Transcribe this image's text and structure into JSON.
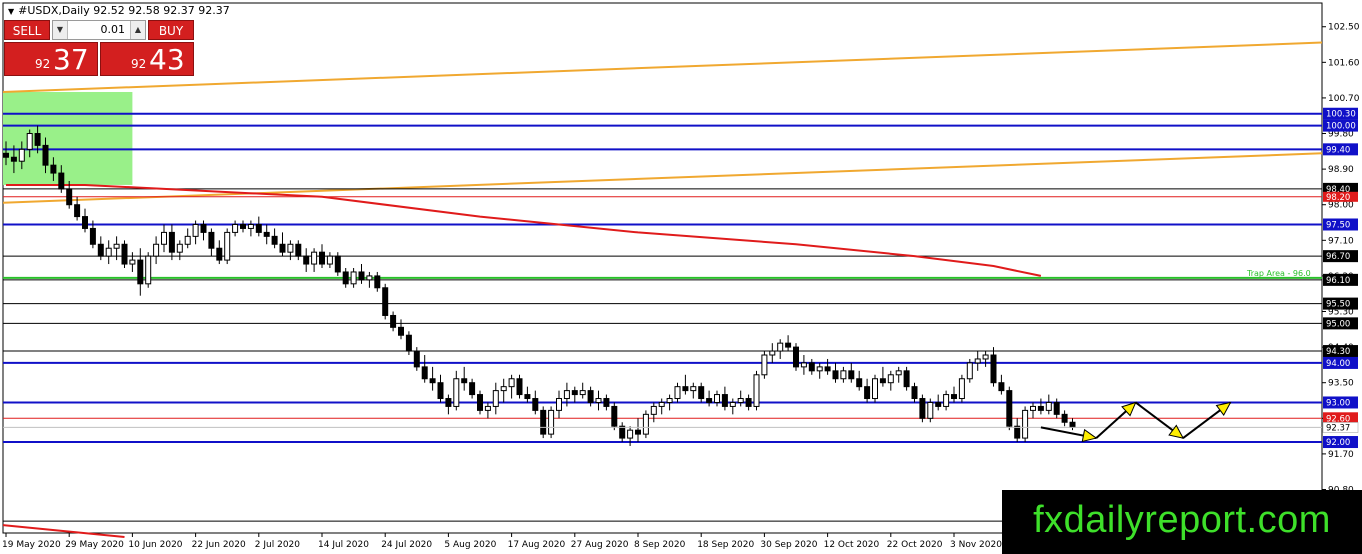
{
  "header": {
    "title_text": "#USDX,Daily  92.52 92.58 92.37 92.37"
  },
  "trade_panel": {
    "sell_label": "SELL",
    "buy_label": "BUY",
    "lot_value": "0.01",
    "sell_price_small": "92",
    "sell_price_big": "37",
    "buy_price_small": "92",
    "buy_price_big": "43"
  },
  "watermark": "fxdailyreport.com",
  "colors": {
    "bull_candle": "#ffffff",
    "bear_candle": "#000000",
    "sma": "#e01b1b",
    "channel": "#f0a830",
    "level_blue": "#1010c8",
    "level_black": "#000000",
    "level_green": "#29c02a",
    "supply_zone": "#99f089",
    "forecast_arrow": "#ffee00"
  },
  "chart_data": {
    "type": "candlestick",
    "symbol": "#USDX",
    "timeframe": "Daily",
    "ylim": [
      89.7,
      103.1
    ],
    "y_ticks": [
      "102.50",
      "101.60",
      "100.70",
      "99.80",
      "98.90",
      "98.00",
      "97.10",
      "96.20",
      "95.30",
      "94.40",
      "93.50",
      "92.60",
      "91.70",
      "90.80"
    ],
    "y_tick_values": [
      102.5,
      101.6,
      100.7,
      99.8,
      98.9,
      98.0,
      97.1,
      96.2,
      95.3,
      94.4,
      93.5,
      92.6,
      91.7,
      90.8
    ],
    "x_labels": [
      "19 May 2020",
      "29 May 2020",
      "10 Jun 2020",
      "22 Jun 2020",
      "2 Jul 2020",
      "14 Jul 2020",
      "24 Jul 2020",
      "5 Aug 2020",
      "17 Aug 2020",
      "27 Aug 2020",
      "8 Sep 2020",
      "18 Sep 2020",
      "30 Sep 2020",
      "12 Oct 2020",
      "22 Oct 2020",
      "3 Nov 2020"
    ],
    "x_label_bars": [
      0,
      8,
      16,
      24,
      32,
      40,
      48,
      56,
      64,
      72,
      80,
      88,
      96,
      104,
      112,
      120
    ],
    "bars_total": 132,
    "candles": [
      [
        99.3,
        99.6,
        99.0,
        99.2
      ],
      [
        99.2,
        99.5,
        98.8,
        99.1
      ],
      [
        99.1,
        99.6,
        98.9,
        99.4
      ],
      [
        99.4,
        99.9,
        99.2,
        99.8
      ],
      [
        99.8,
        100.0,
        99.3,
        99.5
      ],
      [
        99.5,
        99.7,
        98.8,
        99.0
      ],
      [
        99.0,
        99.2,
        98.6,
        98.8
      ],
      [
        98.8,
        99.0,
        98.3,
        98.4
      ],
      [
        98.4,
        98.6,
        97.9,
        98.0
      ],
      [
        98.0,
        98.2,
        97.6,
        97.7
      ],
      [
        97.7,
        97.9,
        97.3,
        97.4
      ],
      [
        97.4,
        97.6,
        96.9,
        97.0
      ],
      [
        97.0,
        97.2,
        96.6,
        96.7
      ],
      [
        96.7,
        97.1,
        96.5,
        96.9
      ],
      [
        96.9,
        97.2,
        96.6,
        97.0
      ],
      [
        97.0,
        97.1,
        96.4,
        96.5
      ],
      [
        96.5,
        96.8,
        96.3,
        96.6
      ],
      [
        96.6,
        96.9,
        95.7,
        96.0
      ],
      [
        96.0,
        96.8,
        95.9,
        96.7
      ],
      [
        96.7,
        97.2,
        96.5,
        97.0
      ],
      [
        97.0,
        97.5,
        96.8,
        97.3
      ],
      [
        97.3,
        97.5,
        96.6,
        96.8
      ],
      [
        96.8,
        97.1,
        96.6,
        97.0
      ],
      [
        97.0,
        97.4,
        96.9,
        97.2
      ],
      [
        97.2,
        97.6,
        97.0,
        97.5
      ],
      [
        97.5,
        97.6,
        97.1,
        97.3
      ],
      [
        97.3,
        97.4,
        96.7,
        96.9
      ],
      [
        96.9,
        97.1,
        96.5,
        96.6
      ],
      [
        96.6,
        97.4,
        96.5,
        97.3
      ],
      [
        97.3,
        97.6,
        97.2,
        97.5
      ],
      [
        97.5,
        97.6,
        97.3,
        97.4
      ],
      [
        97.4,
        97.6,
        97.2,
        97.5
      ],
      [
        97.5,
        97.7,
        97.2,
        97.3
      ],
      [
        97.3,
        97.5,
        97.0,
        97.2
      ],
      [
        97.2,
        97.4,
        96.9,
        97.0
      ],
      [
        97.0,
        97.3,
        96.7,
        96.8
      ],
      [
        96.8,
        97.1,
        96.6,
        97.0
      ],
      [
        97.0,
        97.1,
        96.6,
        96.7
      ],
      [
        96.7,
        96.9,
        96.3,
        96.5
      ],
      [
        96.5,
        96.9,
        96.3,
        96.8
      ],
      [
        96.8,
        97.0,
        96.4,
        96.5
      ],
      [
        96.5,
        96.8,
        96.4,
        96.7
      ],
      [
        96.7,
        96.8,
        96.2,
        96.3
      ],
      [
        96.3,
        96.4,
        95.9,
        96.0
      ],
      [
        96.0,
        96.4,
        95.9,
        96.3
      ],
      [
        96.3,
        96.5,
        96.0,
        96.1
      ],
      [
        96.1,
        96.3,
        95.9,
        96.2
      ],
      [
        96.2,
        96.3,
        95.8,
        95.9
      ],
      [
        95.9,
        96.0,
        95.1,
        95.2
      ],
      [
        95.2,
        95.3,
        94.8,
        94.9
      ],
      [
        94.9,
        95.1,
        94.6,
        94.7
      ],
      [
        94.7,
        94.8,
        94.2,
        94.3
      ],
      [
        94.3,
        94.4,
        93.8,
        93.9
      ],
      [
        93.9,
        94.2,
        93.5,
        93.6
      ],
      [
        93.6,
        93.9,
        93.3,
        93.5
      ],
      [
        93.5,
        93.7,
        93.0,
        93.1
      ],
      [
        93.1,
        93.2,
        92.7,
        92.9
      ],
      [
        92.9,
        93.8,
        92.8,
        93.6
      ],
      [
        93.6,
        93.9,
        93.3,
        93.5
      ],
      [
        93.5,
        93.6,
        93.1,
        93.2
      ],
      [
        93.2,
        93.3,
        92.7,
        92.8
      ],
      [
        92.8,
        93.0,
        92.6,
        92.9
      ],
      [
        92.9,
        93.5,
        92.7,
        93.3
      ],
      [
        93.3,
        93.6,
        93.0,
        93.4
      ],
      [
        93.4,
        93.7,
        93.1,
        93.6
      ],
      [
        93.6,
        93.7,
        93.1,
        93.2
      ],
      [
        93.2,
        93.4,
        93.0,
        93.1
      ],
      [
        93.1,
        93.3,
        92.7,
        92.8
      ],
      [
        92.8,
        92.9,
        92.1,
        92.2
      ],
      [
        92.2,
        92.9,
        92.1,
        92.8
      ],
      [
        92.8,
        93.3,
        92.6,
        93.1
      ],
      [
        93.1,
        93.5,
        92.9,
        93.3
      ],
      [
        93.3,
        93.4,
        93.0,
        93.2
      ],
      [
        93.2,
        93.5,
        93.1,
        93.3
      ],
      [
        93.3,
        93.4,
        92.9,
        93.0
      ],
      [
        93.0,
        93.3,
        92.8,
        93.1
      ],
      [
        93.1,
        93.2,
        92.8,
        92.9
      ],
      [
        92.9,
        93.0,
        92.3,
        92.4
      ],
      [
        92.4,
        92.5,
        92.0,
        92.1
      ],
      [
        92.1,
        92.4,
        91.9,
        92.3
      ],
      [
        92.3,
        92.6,
        92.0,
        92.2
      ],
      [
        92.2,
        92.8,
        92.1,
        92.7
      ],
      [
        92.7,
        93.0,
        92.5,
        92.9
      ],
      [
        92.9,
        93.1,
        92.7,
        93.0
      ],
      [
        93.0,
        93.2,
        92.8,
        93.1
      ],
      [
        93.1,
        93.5,
        93.0,
        93.4
      ],
      [
        93.4,
        93.7,
        93.2,
        93.3
      ],
      [
        93.3,
        93.5,
        93.1,
        93.4
      ],
      [
        93.4,
        93.5,
        93.0,
        93.1
      ],
      [
        93.1,
        93.3,
        92.9,
        93.0
      ],
      [
        93.0,
        93.3,
        92.9,
        93.2
      ],
      [
        93.2,
        93.4,
        92.8,
        92.9
      ],
      [
        92.9,
        93.1,
        92.7,
        93.0
      ],
      [
        93.0,
        93.3,
        92.9,
        93.1
      ],
      [
        93.1,
        93.2,
        92.8,
        92.9
      ],
      [
        92.9,
        93.8,
        92.8,
        93.7
      ],
      [
        93.7,
        94.3,
        93.6,
        94.2
      ],
      [
        94.2,
        94.5,
        94.0,
        94.3
      ],
      [
        94.3,
        94.6,
        94.1,
        94.5
      ],
      [
        94.5,
        94.7,
        94.3,
        94.4
      ],
      [
        94.4,
        94.5,
        93.8,
        93.9
      ],
      [
        93.9,
        94.2,
        93.7,
        94.0
      ],
      [
        94.0,
        94.1,
        93.7,
        93.8
      ],
      [
        93.8,
        94.0,
        93.6,
        93.9
      ],
      [
        93.9,
        94.1,
        93.7,
        93.8
      ],
      [
        93.8,
        94.0,
        93.5,
        93.6
      ],
      [
        93.6,
        93.9,
        93.5,
        93.8
      ],
      [
        93.8,
        94.0,
        93.5,
        93.6
      ],
      [
        93.6,
        93.8,
        93.3,
        93.4
      ],
      [
        93.4,
        93.6,
        93.0,
        93.1
      ],
      [
        93.1,
        93.7,
        93.0,
        93.6
      ],
      [
        93.6,
        93.9,
        93.4,
        93.5
      ],
      [
        93.5,
        93.8,
        93.3,
        93.7
      ],
      [
        93.7,
        93.9,
        93.5,
        93.8
      ],
      [
        93.8,
        93.9,
        93.3,
        93.4
      ],
      [
        93.4,
        93.5,
        93.0,
        93.1
      ],
      [
        93.1,
        93.2,
        92.5,
        92.6
      ],
      [
        92.6,
        93.1,
        92.5,
        93.0
      ],
      [
        93.0,
        93.2,
        92.8,
        92.9
      ],
      [
        92.9,
        93.3,
        92.8,
        93.2
      ],
      [
        93.2,
        93.4,
        93.0,
        93.1
      ],
      [
        93.1,
        93.7,
        93.0,
        93.6
      ],
      [
        93.6,
        94.1,
        93.5,
        94.0
      ],
      [
        94.0,
        94.3,
        93.8,
        94.1
      ],
      [
        94.1,
        94.3,
        93.9,
        94.2
      ],
      [
        94.2,
        94.4,
        93.4,
        93.5
      ],
      [
        93.5,
        93.7,
        93.2,
        93.3
      ],
      [
        93.3,
        93.4,
        92.3,
        92.4
      ],
      [
        92.4,
        92.6,
        92.0,
        92.1
      ],
      [
        92.1,
        92.9,
        92.0,
        92.8
      ],
      [
        92.8,
        93.0,
        92.6,
        92.9
      ],
      [
        92.9,
        93.1,
        92.7,
        92.8
      ],
      [
        92.8,
        93.2,
        92.7,
        93.0
      ],
      [
        93.0,
        93.1,
        92.6,
        92.7
      ],
      [
        92.7,
        92.8,
        92.4,
        92.5
      ],
      [
        92.5,
        92.6,
        92.3,
        92.37
      ]
    ],
    "sma": {
      "start_bar": 0,
      "end_bar": 131,
      "values_at": [
        [
          0,
          98.5
        ],
        [
          10,
          98.5
        ],
        [
          20,
          98.4
        ],
        [
          40,
          98.2
        ],
        [
          60,
          97.7
        ],
        [
          80,
          97.3
        ],
        [
          100,
          97.0
        ],
        [
          115,
          96.7
        ],
        [
          125,
          96.45
        ],
        [
          131,
          96.2
        ]
      ]
    },
    "channel_lines": [
      {
        "y_start": 100.85,
        "y_end": 102.1
      },
      {
        "y_start": 98.05,
        "y_end": 99.3
      }
    ],
    "supply_zone": {
      "from_bar": 0,
      "to_bar": 16,
      "top": 100.85,
      "bottom": 98.5
    },
    "levels": [
      {
        "value": 100.3,
        "label": "100.30",
        "color": "#1010c8"
      },
      {
        "value": 100.0,
        "label": "100.00",
        "color": "#1010c8"
      },
      {
        "value": 99.4,
        "label": "99.40",
        "color": "#1010c8"
      },
      {
        "value": 98.4,
        "label": "98.40",
        "color": "#000000"
      },
      {
        "value": 97.5,
        "label": "97.50",
        "color": "#1010c8"
      },
      {
        "value": 96.7,
        "label": "96.70",
        "color": "#000000"
      },
      {
        "value": 96.1,
        "label": "96.10",
        "color": "#000000"
      },
      {
        "value": 95.5,
        "label": "95.50",
        "color": "#000000"
      },
      {
        "value": 95.0,
        "label": "95.00",
        "color": "#000000"
      },
      {
        "value": 94.3,
        "label": "94.30",
        "color": "#000000"
      },
      {
        "value": 94.0,
        "label": "94.00",
        "color": "#1010c8"
      },
      {
        "value": 93.0,
        "label": "93.00",
        "color": "#1010c8"
      },
      {
        "value": 92.6,
        "label": "92.60",
        "color": "#e01b1b"
      },
      {
        "value": 92.0,
        "label": "92.00",
        "color": "#1010c8"
      }
    ],
    "red_level_label": {
      "value": 98.2,
      "label": "98.20"
    },
    "trap_area": {
      "value": 96.1,
      "label": "Trap Area - 96.0"
    },
    "current_price": {
      "value": 92.37,
      "label": "92.37"
    },
    "bottom_level": {
      "value": 90.0
    },
    "lower_red_line": {
      "from_bar": 0,
      "to_bar": 15,
      "y_start": 89.9,
      "y_end": 89.6
    },
    "forecast_path": [
      [
        131,
        92.37
      ],
      [
        138,
        92.1
      ],
      [
        143,
        93.0
      ],
      [
        149,
        92.1
      ],
      [
        155,
        93.0
      ]
    ]
  }
}
